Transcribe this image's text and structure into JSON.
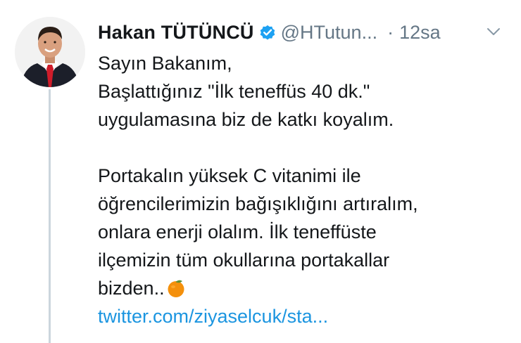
{
  "tweet": {
    "author_name": "Hakan TÜTÜNCÜ",
    "handle": "@HTutun...",
    "separator": "·",
    "time": "12sa",
    "lines": [
      "Sayın Bakanım,",
      "Başlattığınız \"İlk teneffüs 40 dk.\"",
      "uygulamasına biz de katkı koyalım.",
      "Portakalın yüksek C vitanimi ile",
      "öğrencilerimizin bağışıklığını artıralım,",
      "onlara enerji olalım. İlk teneffüste",
      "ilçemizin tüm okullarına portakallar",
      "bizden.."
    ],
    "link_text": "twitter.com/ziyaselcuk/sta..."
  },
  "icons": {
    "verified": "verified-badge-icon",
    "menu": "chevron-down-icon",
    "emoji": "orange-emoji-icon"
  },
  "colors": {
    "text": "#14171a",
    "secondary": "#657786",
    "link": "#1b95e0",
    "verified": "#1da1f2",
    "thread_line": "#ccd6dd",
    "orange": "#f4900c"
  }
}
